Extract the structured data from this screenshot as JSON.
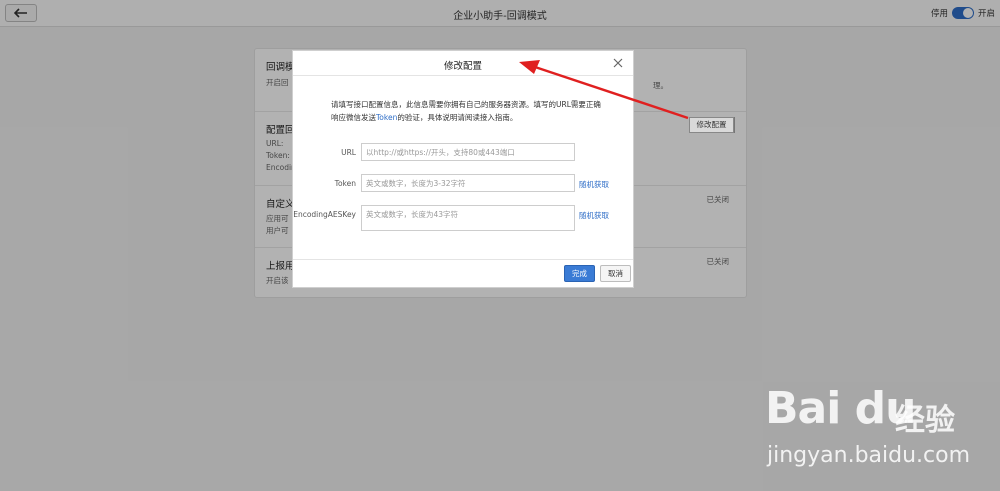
{
  "topbar": {
    "title": "企业小助手-回调模式",
    "toggle_off_label": "停用",
    "toggle_on_label": "开启",
    "toggle_state": "on",
    "accent": "#2f6ec7"
  },
  "background_card": {
    "sections": [
      {
        "title": "回调模",
        "lines": [
          "开启回"
        ],
        "trail": "理。"
      },
      {
        "title": "配置回",
        "lines": [
          "URL:",
          "Token:",
          "Encodin"
        ],
        "button": "修改配置"
      },
      {
        "title": "自定义",
        "lines": [
          "应用可",
          "用户可"
        ],
        "status": "已关闭"
      },
      {
        "title": "上报用",
        "lines": [
          "开启该"
        ],
        "status": "已关闭"
      }
    ]
  },
  "modal": {
    "title": "修改配置",
    "intro_prefix": "请填写接口配置信息，此信息需要你拥有自己的服务器资源。填写的URL需要正确响应微信发送",
    "intro_link": "Token",
    "intro_suffix": "的验证，具体说明请阅读接入指南。",
    "fields": {
      "url": {
        "label": "URL",
        "placeholder": "以http://或https://开头，支持80或443端口"
      },
      "token": {
        "label": "Token",
        "placeholder": "英文或数字，长度为3-32字符",
        "action": "随机获取"
      },
      "aes": {
        "label": "EncodingAESKey",
        "placeholder": "英文或数字，长度为43字符",
        "action": "随机获取"
      }
    },
    "done_label": "完成",
    "cancel_label": "取消",
    "primary_color": "#3a7bd5"
  },
  "annotation": {
    "arrow_color": "#e02020"
  },
  "watermark": {
    "logo": "Bai du",
    "cn": "经验",
    "url": "jingyan.baidu.com"
  }
}
